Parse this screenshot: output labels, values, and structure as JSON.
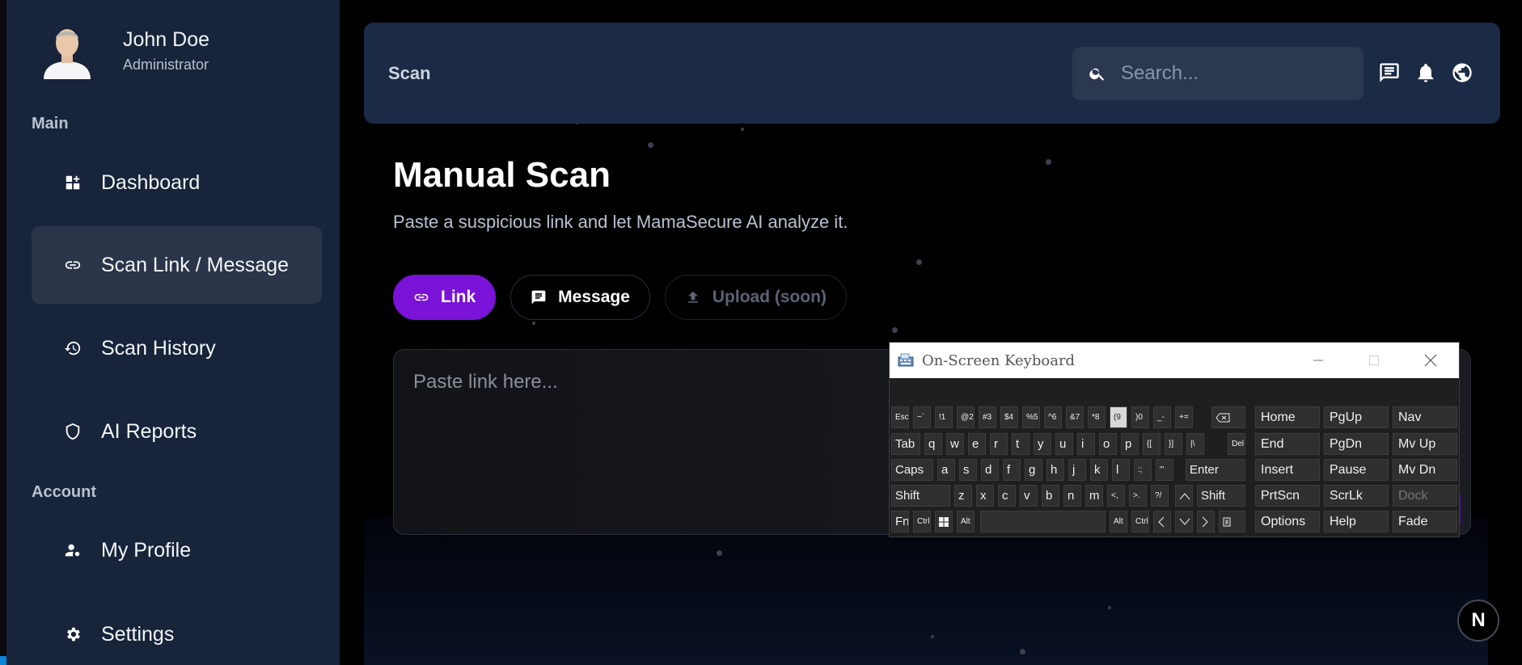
{
  "profile": {
    "name": "John Doe",
    "role": "Administrator"
  },
  "sidebar": {
    "sections": {
      "main": "Main",
      "account": "Account"
    },
    "items": [
      {
        "label": "Dashboard",
        "icon": "dashboard-icon"
      },
      {
        "label": "Scan Link / Message",
        "icon": "link-icon",
        "active": true
      },
      {
        "label": "Scan History",
        "icon": "history-icon"
      },
      {
        "label": "AI Reports",
        "icon": "shield-icon"
      },
      {
        "label": "My Profile",
        "icon": "user-settings-icon"
      },
      {
        "label": "Settings",
        "icon": "gear-icon"
      }
    ]
  },
  "header": {
    "title": "Scan",
    "search_placeholder": "Search...",
    "icons": [
      "chat-icon",
      "bell-icon",
      "globe-icon"
    ]
  },
  "main": {
    "title": "Manual Scan",
    "subtitle": "Paste a suspicious link and let MamaSecure AI analyze it.",
    "tabs": [
      {
        "label": "Link",
        "icon": "link-icon"
      },
      {
        "label": "Message",
        "icon": "chat-icon"
      },
      {
        "label": "Upload (soon)",
        "icon": "upload-icon"
      }
    ],
    "input_placeholder": "Paste link here..."
  },
  "badge": {
    "label": "N"
  },
  "osk": {
    "title": "On-Screen Keyboard",
    "keys": {
      "esc": "Esc",
      "tab": "Tab",
      "caps": "Caps",
      "shift": "Shift",
      "fn": "Fn",
      "ctrl": "Ctrl",
      "alt": "Alt",
      "del": "Del",
      "enter": "Enter",
      "row1": [
        "~`",
        "!1",
        "@2",
        "#3",
        "$4",
        "%5",
        "^6",
        "&7",
        "*8",
        "(9",
        ")0",
        "_-",
        "+="
      ],
      "row2": [
        "q",
        "w",
        "e",
        "r",
        "t",
        "y",
        "u",
        "i",
        "o",
        "p",
        "{[",
        "}]",
        "|\\"
      ],
      "row3": [
        "a",
        "s",
        "d",
        "f",
        "g",
        "h",
        "j",
        "k",
        "l",
        ":;",
        "\"'"
      ],
      "row4": [
        "z",
        "x",
        "c",
        "v",
        "b",
        "n",
        "m",
        "<,",
        ">.",
        "?/"
      ],
      "nav": [
        "Home",
        "PgUp",
        "Nav",
        "End",
        "PgDn",
        "Mv Up",
        "Insert",
        "Pause",
        "Mv Dn",
        "PrtScn",
        "ScrLk",
        "Dock",
        "Options",
        "Help",
        "Fade"
      ]
    }
  },
  "colors": {
    "accent": "#7a12d8",
    "sidebar_bg": "#17243a",
    "header_bg": "#1b2a45"
  }
}
